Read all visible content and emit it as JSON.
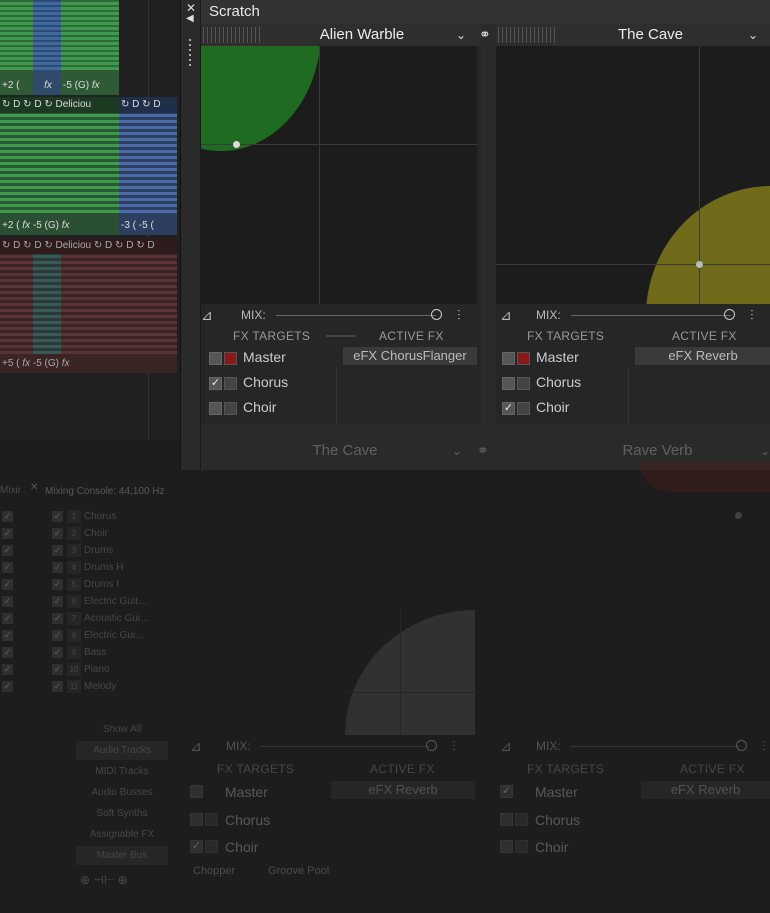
{
  "tracks": {
    "row1": {
      "footers": [
        "+2 (",
        "fx",
        "-5 (G)",
        "fx"
      ]
    },
    "row2": {
      "headers": [
        "D",
        "D",
        "Deliciou",
        "D",
        "D"
      ],
      "footers": [
        "+2 (",
        "fx",
        "-5 (G)",
        "fx",
        "-3 (",
        "-5 ("
      ]
    },
    "row3": {
      "headers": [
        "D",
        "D",
        "Deliciou",
        "D",
        "D",
        "D"
      ],
      "footers": [
        "+5 (",
        "fx",
        "-5 (G)",
        "fx"
      ]
    }
  },
  "scratch": {
    "title": "Scratch",
    "close_icon": "✕",
    "arrow_icon": "◀",
    "units": [
      {
        "preset": "Alien Warble",
        "blob_color": "#1f6b22",
        "active_fx": "eFX ChorusFlanger",
        "targets": [
          {
            "name": "Master",
            "checked": false
          },
          {
            "name": "Chorus",
            "checked": true
          },
          {
            "name": "Choir",
            "checked": false
          }
        ]
      },
      {
        "preset": "The Cave",
        "blob_color": "#6f6b1a",
        "active_fx": "eFX Reverb",
        "targets": [
          {
            "name": "Master",
            "checked": false
          },
          {
            "name": "Chorus",
            "checked": false
          },
          {
            "name": "Choir",
            "checked": true
          }
        ]
      },
      {
        "preset": "The Cave",
        "active_fx": "eFX Reverb",
        "targets": [
          {
            "name": "Master",
            "checked": false
          },
          {
            "name": "Chorus",
            "checked": false
          },
          {
            "name": "Choir",
            "checked": true
          }
        ]
      },
      {
        "preset": "Rave Verb",
        "active_fx": "eFX Reverb",
        "targets": [
          {
            "name": "Master",
            "checked": true
          },
          {
            "name": "Chorus",
            "checked": false
          },
          {
            "name": "Choir",
            "checked": false
          }
        ]
      }
    ],
    "mix_label": "MIX:",
    "fx_targets_label": "FX TARGETS",
    "active_fx_label": "ACTIVE FX",
    "link_icon": "⚭"
  },
  "console": {
    "header_left": "Mixir",
    "header": "Mixing Console: 44,100 Hz",
    "channels": [
      {
        "num": "1",
        "name": "Chorus"
      },
      {
        "num": "2",
        "name": "Choir"
      },
      {
        "num": "3",
        "name": "Drums"
      },
      {
        "num": "4",
        "name": "Drums H"
      },
      {
        "num": "5",
        "name": "Drums I"
      },
      {
        "num": "6",
        "name": "Electric Guit…"
      },
      {
        "num": "7",
        "name": "Acoustic Gui…"
      },
      {
        "num": "8",
        "name": "Electric Gui…"
      },
      {
        "num": "9",
        "name": "Bass"
      },
      {
        "num": "10",
        "name": "Piano"
      },
      {
        "num": "11",
        "name": "Melody"
      }
    ],
    "nav": [
      "Show All",
      "Audio Tracks",
      "MIDI Tracks",
      "Audio Busses",
      "Soft Synths",
      "Assignable FX",
      "Master Bus"
    ],
    "bottom_tabs": [
      "Chopper",
      "Groove Pool"
    ]
  }
}
